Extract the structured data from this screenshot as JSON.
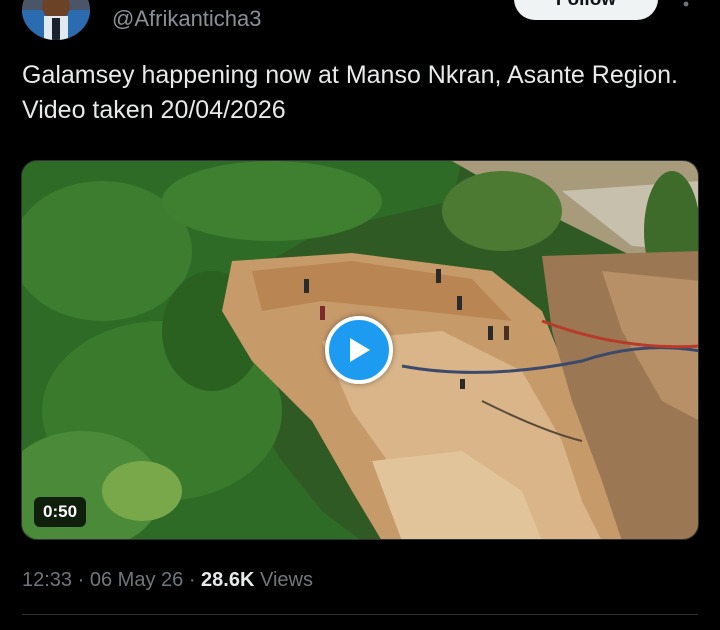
{
  "author": {
    "handle": "@Afrikanticha3",
    "follow_label": "Follow"
  },
  "post": {
    "text": "Galamsey happening now at Manso Nkran, Asante Region. Video taken 20/04/2026"
  },
  "video": {
    "duration": "0:50"
  },
  "meta": {
    "time": "12:33",
    "sep1": "·",
    "date": "06 May 26",
    "sep2": "·",
    "views_count": "28.6K",
    "views_label": "Views"
  },
  "colors": {
    "background": "#000000",
    "text": "#e7e9ea",
    "muted": "#71767b",
    "accent": "#1d9bf0"
  },
  "icons": [
    "avatar",
    "more-icon",
    "play-icon"
  ]
}
